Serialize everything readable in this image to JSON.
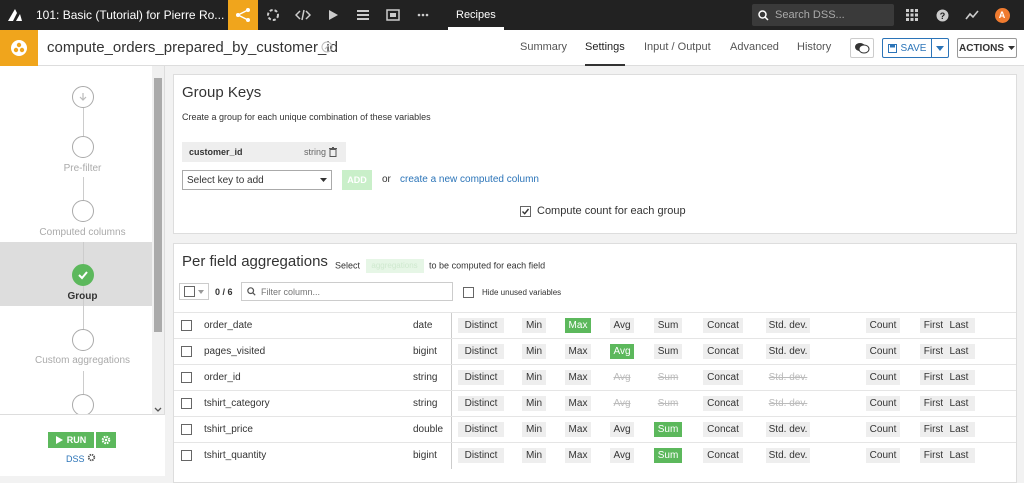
{
  "topbar": {
    "project_title": "101: Basic (Tutorial) for Pierre Ro...",
    "recipes_label": "Recipes",
    "search_placeholder": "Search DSS...",
    "avatar_letter": "A"
  },
  "recipe": {
    "name": "compute_orders_prepared_by_customer_id",
    "tabs": [
      "Summary",
      "Settings",
      "Input / Output",
      "Advanced",
      "History"
    ],
    "active_tab": "Settings",
    "save_label": "SAVE",
    "actions_label": "ACTIONS"
  },
  "steps": [
    {
      "label": "",
      "state": "info"
    },
    {
      "label": "Pre-filter",
      "state": "empty"
    },
    {
      "label": "Computed columns",
      "state": "empty"
    },
    {
      "label": "Group",
      "state": "done"
    },
    {
      "label": "Custom aggregations",
      "state": "empty"
    },
    {
      "label": "",
      "state": "empty"
    }
  ],
  "run": {
    "label": "RUN",
    "engine": "DSS"
  },
  "group_keys": {
    "title": "Group Keys",
    "description": "Create a group for each unique combination of these variables",
    "keys": [
      {
        "name": "customer_id",
        "type": "string"
      }
    ],
    "select_placeholder": "Select key to add",
    "add_label": "ADD",
    "or_text": "or",
    "computed_link": "create a new computed column",
    "count_label": "Compute count for each group",
    "count_checked": true
  },
  "aggregations": {
    "title": "Per field aggregations",
    "sub_before": "Select",
    "sub_pill": "aggregations",
    "sub_after": "to be computed for each field",
    "selection_count": "0 / 6",
    "filter_placeholder": "Filter column...",
    "hide_unused_label": "Hide unused variables",
    "agg_names": [
      "Distinct",
      "Min",
      "Max",
      "Avg",
      "Sum",
      "Concat",
      "Std. dev.",
      "Count",
      "First",
      "Last"
    ],
    "fields": [
      {
        "name": "order_date",
        "type": "date",
        "on": [
          "Max"
        ],
        "na": []
      },
      {
        "name": "pages_visited",
        "type": "bigint",
        "on": [
          "Avg"
        ],
        "na": []
      },
      {
        "name": "order_id",
        "type": "string",
        "on": [],
        "na": [
          "Avg",
          "Sum",
          "Std. dev."
        ]
      },
      {
        "name": "tshirt_category",
        "type": "string",
        "on": [],
        "na": [
          "Avg",
          "Sum",
          "Std. dev."
        ]
      },
      {
        "name": "tshirt_price",
        "type": "double",
        "on": [
          "Sum"
        ],
        "na": []
      },
      {
        "name": "tshirt_quantity",
        "type": "bigint",
        "on": [
          "Sum"
        ],
        "na": []
      }
    ]
  },
  "colors": {
    "accent": "#f0a51c",
    "green": "#5cb85c",
    "blue": "#2b74b8",
    "topbar": "#222222"
  }
}
